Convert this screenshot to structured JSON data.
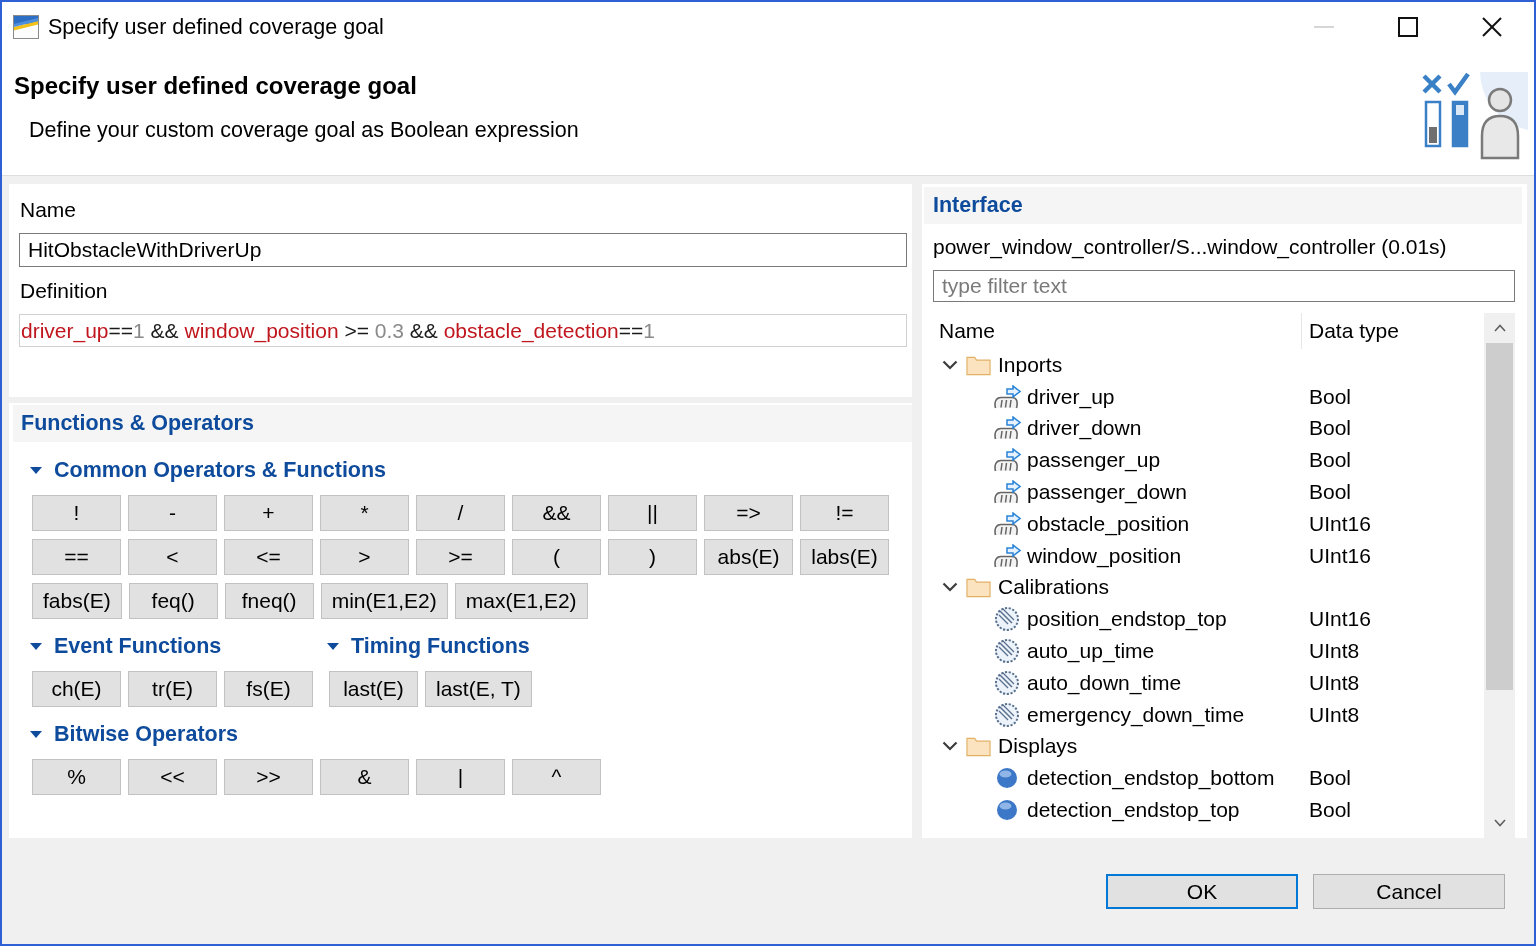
{
  "window": {
    "title": "Specify user defined coverage goal",
    "minimize_enabled": false
  },
  "header": {
    "title": "Specify user defined coverage goal",
    "description": "Define your custom coverage goal as Boolean expression"
  },
  "form": {
    "name": {
      "label": "Name",
      "value": "HitObstacleWithDriverUp"
    },
    "definition": {
      "label": "Definition",
      "tokens": [
        {
          "text": "driver_up",
          "kind": "signal"
        },
        {
          "text": "==",
          "kind": "operator"
        },
        {
          "text": "1",
          "kind": "number"
        },
        {
          "text": " && ",
          "kind": "operator"
        },
        {
          "text": "window_position",
          "kind": "signal"
        },
        {
          "text": " >= ",
          "kind": "operator"
        },
        {
          "text": "0.3",
          "kind": "number"
        },
        {
          "text": " && ",
          "kind": "operator"
        },
        {
          "text": "obstacle_detection",
          "kind": "signal"
        },
        {
          "text": "==",
          "kind": "operator"
        },
        {
          "text": "1",
          "kind": "number"
        }
      ]
    }
  },
  "functions": {
    "title": "Functions & Operators",
    "rows": [
      {
        "groups": [
          {
            "title": "Common Operators & Functions",
            "expanded": true,
            "buttons": [
              "!",
              "-",
              "+",
              "*",
              "/",
              "&&",
              "||",
              "=>",
              "!=",
              "==",
              "<",
              "<=",
              ">",
              ">=",
              "(",
              ")",
              "abs(E)",
              "labs(E)",
              "fabs(E)",
              "feq()",
              "fneq()",
              "min(E1,E2)",
              "max(E1,E2)"
            ]
          }
        ]
      },
      {
        "groups": [
          {
            "title": "Event Functions",
            "expanded": true,
            "buttons": [
              "ch(E)",
              "tr(E)",
              "fs(E)"
            ]
          },
          {
            "title": "Timing Functions",
            "expanded": true,
            "buttons": [
              "last(E)",
              "last(E, T)"
            ]
          }
        ]
      },
      {
        "groups": [
          {
            "title": "Bitwise Operators",
            "expanded": true,
            "buttons": [
              "%",
              "<<",
              ">>",
              "&",
              "|",
              "^"
            ]
          }
        ]
      }
    ]
  },
  "interface": {
    "title": "Interface",
    "path": "power_window_controller/S...window_controller (0.01s)",
    "filter": {
      "placeholder": "type filter text"
    },
    "columns": [
      "Name",
      "Data type"
    ],
    "tree": [
      {
        "label": "Inports",
        "kind": "folder",
        "expanded": true,
        "children": [
          {
            "label": "driver_up",
            "kind": "inport",
            "type": "Bool"
          },
          {
            "label": "driver_down",
            "kind": "inport",
            "type": "Bool"
          },
          {
            "label": "passenger_up",
            "kind": "inport",
            "type": "Bool"
          },
          {
            "label": "passenger_down",
            "kind": "inport",
            "type": "Bool"
          },
          {
            "label": "obstacle_position",
            "kind": "inport",
            "type": "UInt16"
          },
          {
            "label": "window_position",
            "kind": "inport",
            "type": "UInt16"
          }
        ]
      },
      {
        "label": "Calibrations",
        "kind": "folder",
        "expanded": true,
        "children": [
          {
            "label": "position_endstop_top",
            "kind": "calibration",
            "type": "UInt16"
          },
          {
            "label": "auto_up_time",
            "kind": "calibration",
            "type": "UInt8"
          },
          {
            "label": "auto_down_time",
            "kind": "calibration",
            "type": "UInt8"
          },
          {
            "label": "emergency_down_time",
            "kind": "calibration",
            "type": "UInt8"
          }
        ]
      },
      {
        "label": "Displays",
        "kind": "folder",
        "expanded": true,
        "children": [
          {
            "label": "detection_endstop_bottom",
            "kind": "display",
            "type": "Bool"
          },
          {
            "label": "detection_endstop_top",
            "kind": "display",
            "type": "Bool"
          }
        ]
      }
    ]
  },
  "buttons": [
    {
      "label": "OK",
      "default": true
    },
    {
      "label": "Cancel",
      "default": false
    }
  ]
}
